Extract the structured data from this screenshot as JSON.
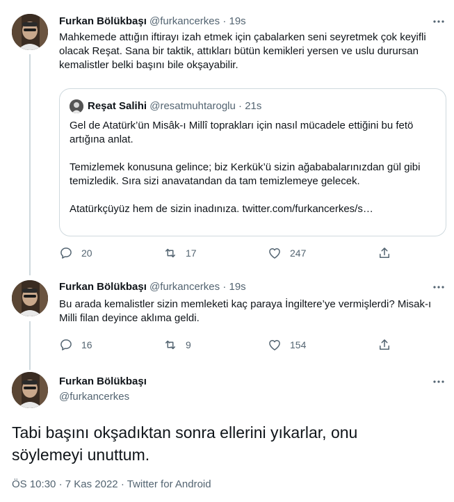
{
  "tweet1": {
    "name": "Furkan Bölükbaşı",
    "handle": "@furkancerkes",
    "time": "19s",
    "text": "Mahkemede attığın iftirayı izah etmek için çabalarken seni seyretmek çok keyifli olacak Reşat. Sana bir taktik, attıkları bütün kemikleri yersen ve uslu durursan kemalistler belki başını bile okşayabilir.",
    "quote": {
      "name": "Reşat Salihi",
      "handle": "@resatmuhtaroglu",
      "time": "21s",
      "para1": "Gel de Atatürk’ün Misâk-ı Millî toprakları için nasıl mücadele ettiğini bu fetö artığına anlat.",
      "para2": "Temizlemek konusuna gelince; biz Kerkük’ü sizin ağababalarınızdan gül gibi temizledik. Sıra sizi anavatandan da tam temizlemeye gelecek.",
      "para3": "Atatürkçüyüz hem de sizin inadınıza. twitter.com/furkancerkes/s…"
    },
    "replies": "20",
    "retweets": "17",
    "likes": "247"
  },
  "tweet2": {
    "name": "Furkan Bölükbaşı",
    "handle": "@furkancerkes",
    "time": "19s",
    "text": "Bu arada kemalistler sizin memleketi kaç paraya İngiltere’ye vermişlerdi? Misak-ı Milli filan deyince aklıma geldi.",
    "replies": "16",
    "retweets": "9",
    "likes": "154"
  },
  "main_tweet": {
    "name": "Furkan Bölükbaşı",
    "handle": "@furkancerkes",
    "text": "Tabi başını okşadıktan sonra ellerini yıkarlar, onu söylemeyi unuttum.",
    "time": "ÖS 10:30",
    "date": "7 Kas 2022",
    "source": "Twitter for Android",
    "separator": "·"
  },
  "icons": {
    "more": "more-icon",
    "reply": "reply-icon",
    "retweet": "retweet-icon",
    "like": "like-icon",
    "share": "share-icon"
  },
  "colors": {
    "text": "#0f1419",
    "secondary": "#536471",
    "border": "#cfd9de"
  }
}
